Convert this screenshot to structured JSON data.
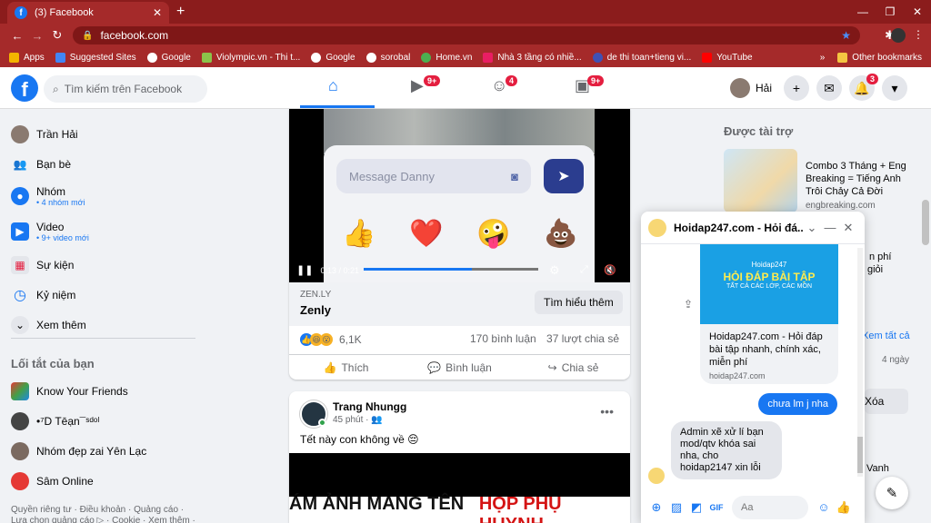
{
  "browser": {
    "tab_title": "(3) Facebook",
    "url": "facebook.com",
    "bookmarks": [
      "Apps",
      "Suggested Sites",
      "Google",
      "Violympic.vn - Thi t...",
      "Google",
      "sorobal",
      "Home.vn",
      "Nhà 3 tầng có nhiề...",
      "de thi toan+tieng vi...",
      "YouTube"
    ],
    "bookmarks_more": "»",
    "other_bookmarks": "Other bookmarks"
  },
  "fbnav": {
    "logo": "f",
    "search_placeholder": "Tìm kiếm trên Facebook",
    "badges": {
      "watch": "9+",
      "groups": "4",
      "gaming": "9+",
      "notifications": "3"
    },
    "user_name": "Hải"
  },
  "sidebar": {
    "items": [
      {
        "label": "Trần Hải"
      },
      {
        "label": "Bạn bè"
      },
      {
        "label": "Nhóm",
        "sub": "• 4 nhóm mới"
      },
      {
        "label": "Video",
        "sub": "• 9+ video mới"
      },
      {
        "label": "Sự kiện"
      },
      {
        "label": "Kỷ niệm"
      },
      {
        "label": "Xem thêm"
      }
    ],
    "shortcuts_title": "Lối tắt của bạn",
    "shortcuts": [
      "Know Your Friends",
      "•⁷D Tēạn¯ˢᵈᵒˡ",
      "Nhóm đẹp zai Yên Lạc",
      "Sâm Online"
    ],
    "footer": "Quyền riêng tư · Điều khoản · Quảng cáo · Lựa chọn quảng cáo ▷ · Cookie · Xem thêm ·"
  },
  "post1": {
    "video": {
      "placeholder": "Message Danny",
      "time": "0:13 / 0:21",
      "progress": 0.62,
      "emojis": [
        "👍",
        "❤️",
        "🤪",
        "💩"
      ]
    },
    "ad_source": "ZEN.LY",
    "ad_name": "Zenly",
    "learn_more": "Tìm hiểu thêm",
    "reactions_count": "6,1K",
    "comments": "170 bình luận",
    "shares": "37 lượt chia sẻ",
    "actions": [
      "Thích",
      "Bình luận",
      "Chia sẻ"
    ]
  },
  "post2": {
    "author": "Trang Nhungg",
    "time": "45 phút ·",
    "text": "Tết này con không về 😔",
    "banner_black": "ÁM ẢNH MANG TÊN -",
    "banner_red": "HỌP PHỤ HUYNH"
  },
  "right": {
    "sponsored": "Được tài trợ",
    "ad_text": "Combo 3 Tháng + Eng Breaking = Tiếng Anh Trôi Chảy Cả Đời",
    "ad_url": "engbreaking.com",
    "peek": [
      "n phí",
      "giỏi",
      "Xem tất cả",
      "4 ngày",
      "Xóa",
      "Vanh"
    ]
  },
  "chat": {
    "name": "Hoidap247.com - Hỏi đá...",
    "card_brand": "Hoidap247",
    "card_big": "HỎI ĐÁP BÀI TẬP",
    "card_small": "TẤT CẢ CÁC LỚP, CÁC MÔN",
    "card_title": "Hoidap247.com - Hỏi đáp bài tập nhanh, chính xác, miễn phí",
    "card_url": "hoidap247.com",
    "msg_out": "chưa lm j nha",
    "msg_in": "Admin xẽ xử lí bạn mod/qtv khóa sai nha, cho hoidap2147 xin lỗi",
    "input_placeholder": "Aa"
  }
}
